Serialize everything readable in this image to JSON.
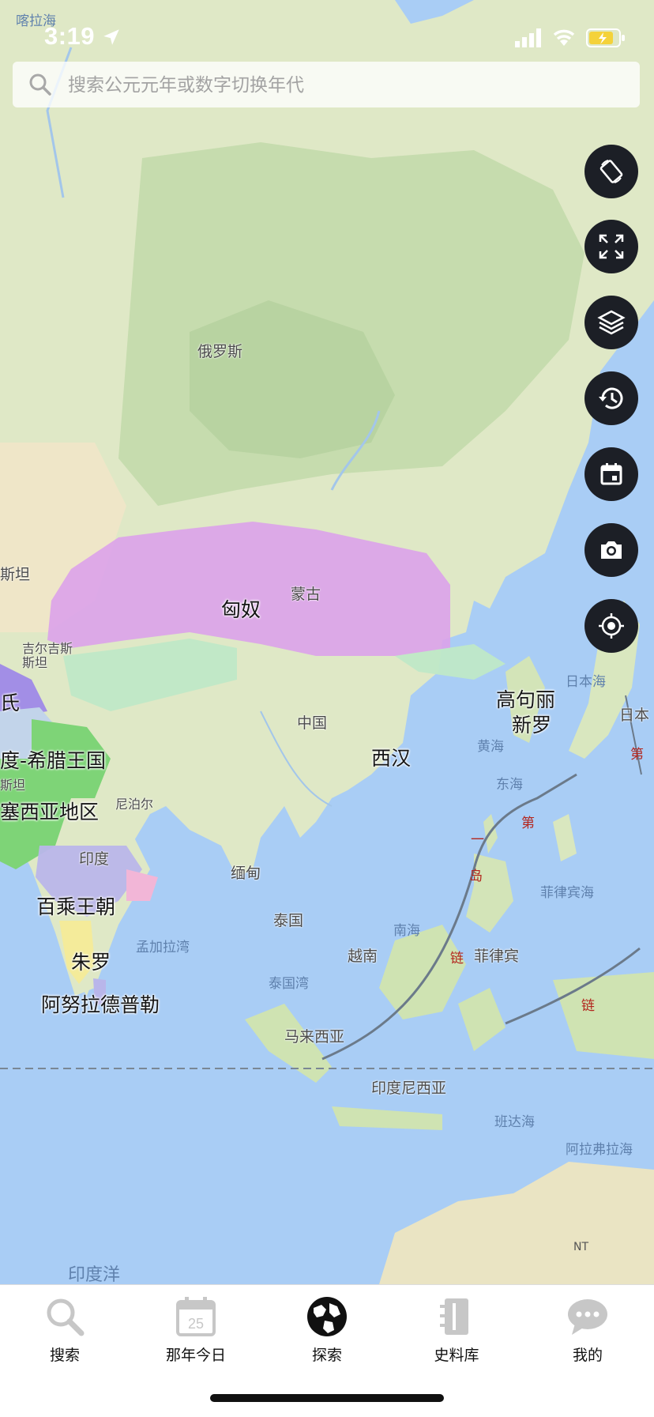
{
  "status_bar": {
    "time": "3:19"
  },
  "search": {
    "placeholder": "搜索公元元年或数字切换年代"
  },
  "map": {
    "polities": [
      "匈奴",
      "西汉",
      "高句丽",
      "新罗",
      "度-希腊王国",
      "塞西亚地区",
      "百乘王朝",
      "朱罗",
      "阿努拉德普勒",
      "氏"
    ],
    "countries": [
      "俄罗斯",
      "蒙古",
      "中国",
      "缅甸",
      "泰国",
      "越南",
      "马来西亚",
      "印度尼西亚",
      "印度",
      "尼泊尔",
      "孟加拉湾",
      "吉尔吉斯\n斯坦",
      "斯坦",
      "斯坦"
    ],
    "seas": [
      "喀拉海",
      "日本海",
      "黄海",
      "东海",
      "南海",
      "菲律宾海",
      "泰国湾",
      "班达海",
      "阿拉弗拉海",
      "印度洋"
    ],
    "labels_other": [
      "日本",
      "菲律宾"
    ],
    "island_chain_chars": [
      "第",
      "一",
      "岛",
      "链",
      "第",
      "链"
    ],
    "corner_label": "NT",
    "colors": {
      "xiongnu": "#dba2ea",
      "han_border_green": "#bfe8c7",
      "indo_green": "#7ed477",
      "satavahana": "#b9b6ea",
      "purple_west": "#a28ee6",
      "ocean": "#a9cdf5"
    }
  },
  "fabs": [
    {
      "name": "rotate-screen",
      "icon": "rotate-icon"
    },
    {
      "name": "fullscreen",
      "icon": "expand-icon"
    },
    {
      "name": "layers",
      "icon": "layers-icon"
    },
    {
      "name": "history",
      "icon": "history-icon"
    },
    {
      "name": "calendar",
      "icon": "calendar-icon"
    },
    {
      "name": "camera",
      "icon": "camera-icon"
    },
    {
      "name": "locate",
      "icon": "crosshair-icon"
    }
  ],
  "tabbar": {
    "tabs": [
      {
        "label": "搜索",
        "icon": "search-icon"
      },
      {
        "label": "那年今日",
        "icon": "calendar-icon",
        "date": "25"
      },
      {
        "label": "探索",
        "icon": "globe-icon",
        "active": true
      },
      {
        "label": "史料库",
        "icon": "archive-icon"
      },
      {
        "label": "我的",
        "icon": "chat-icon"
      }
    ]
  }
}
